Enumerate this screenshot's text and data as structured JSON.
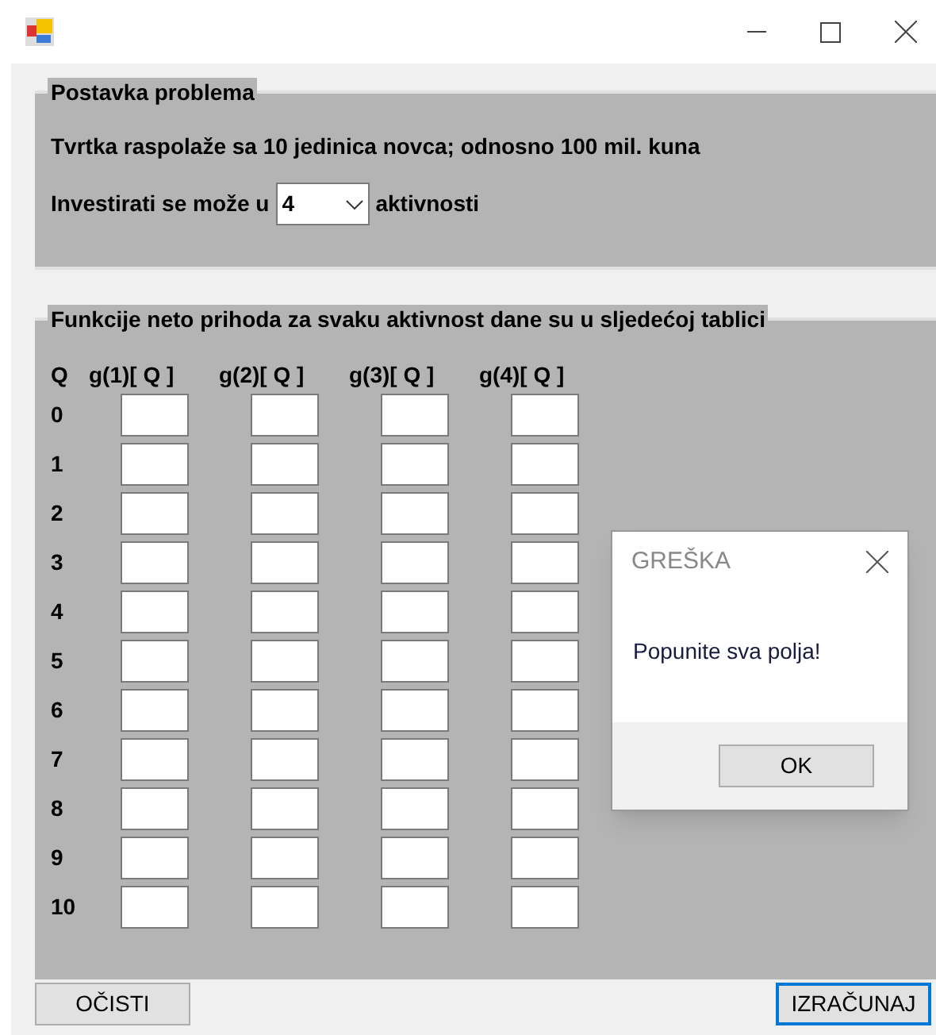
{
  "problem_group": {
    "title": "Postavka problema",
    "statement": "Tvrtka raspolaže sa 10 jedinica novca; odnosno 100 mil. kuna",
    "invest_label": "Investirati se može u",
    "activities_value": "4",
    "activities_suffix": "aktivnosti"
  },
  "functions_group": {
    "title": "Funkcije neto prihoda za svaku aktivnost dane su u sljedećoj tablici",
    "columns": [
      "Q",
      "g(1)[ Q ]",
      "g(2)[ Q ]",
      "g(3)[ Q ]",
      "g(4)[ Q ]"
    ],
    "rows": [
      "0",
      "1",
      "2",
      "3",
      "4",
      "5",
      "6",
      "7",
      "8",
      "9",
      "10"
    ]
  },
  "buttons": [
    {
      "label": "OČISTI",
      "focused": false
    },
    {
      "label": "IZRAČUNAJ",
      "focused": true
    }
  ],
  "dialog": {
    "title": "GREŠKA",
    "message": "Popunite sva polja!",
    "button": "OK"
  }
}
